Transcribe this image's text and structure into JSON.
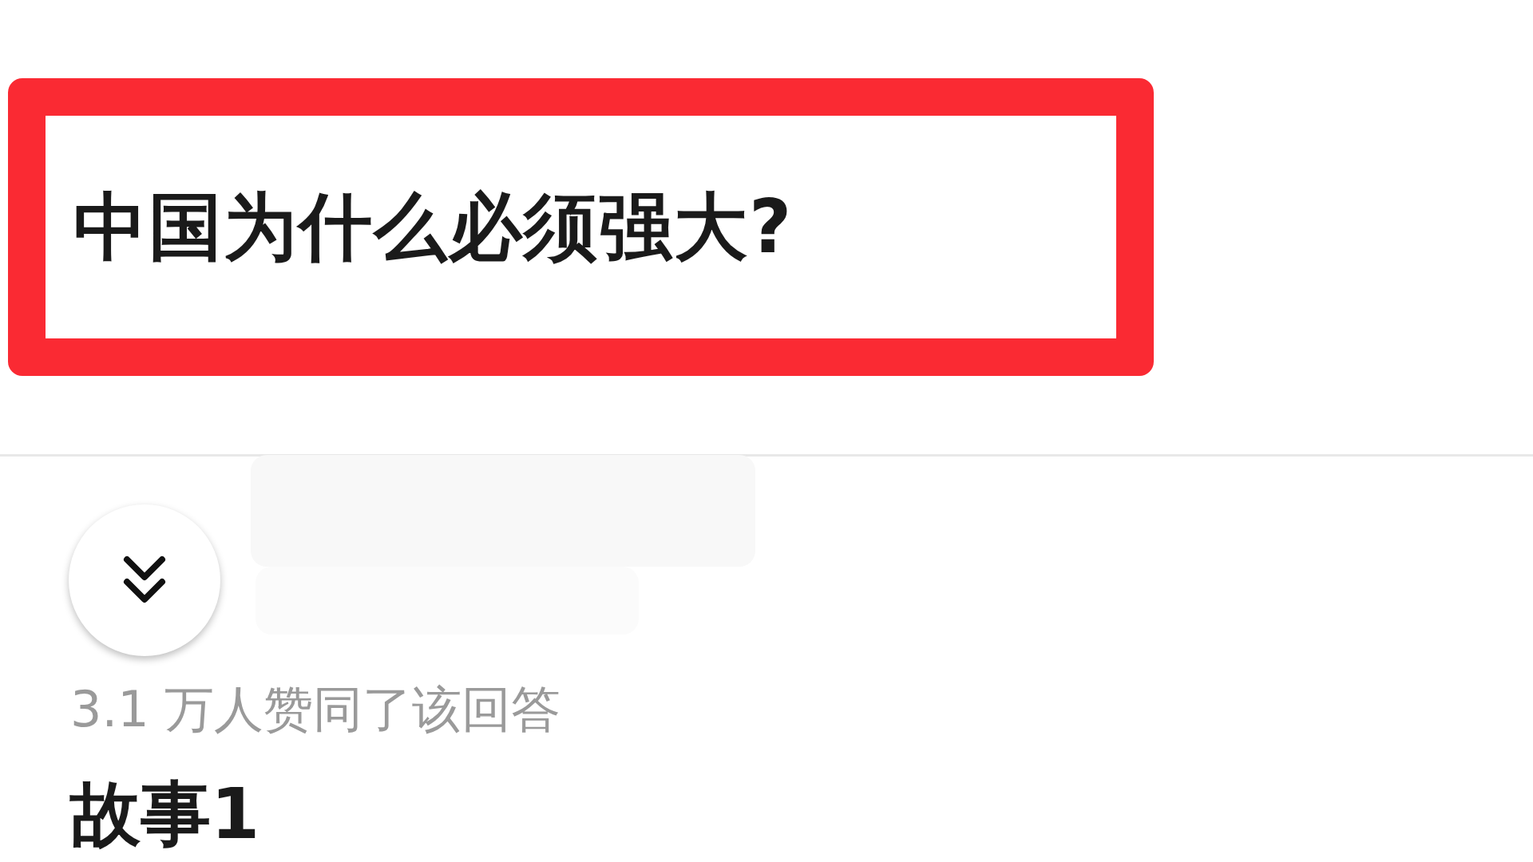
{
  "question": {
    "title": "中国为什么必须强大?",
    "highlighted": true
  },
  "answer": {
    "votes": "3.1 万人赞同了该回答",
    "heading": "故事1"
  }
}
